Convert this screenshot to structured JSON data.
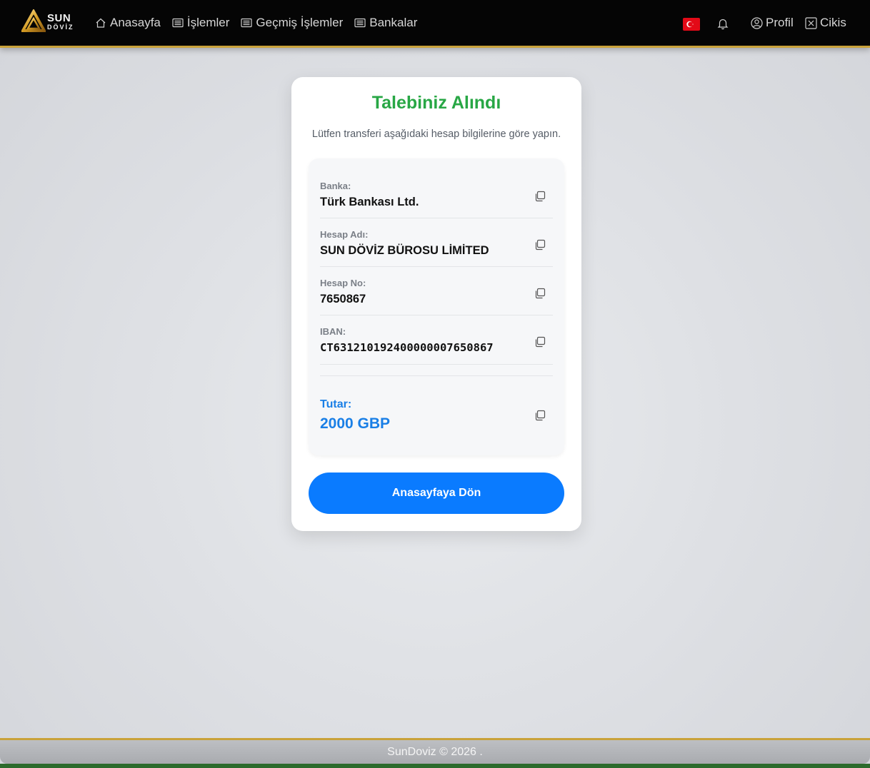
{
  "nav": {
    "logo_sun": "SUN",
    "logo_doviz": "DÖVİZ",
    "links": [
      {
        "label": "Anasayfa",
        "icon": "home-icon"
      },
      {
        "label": "İşlemler",
        "icon": "list-icon"
      },
      {
        "label": "Geçmiş İşlemler",
        "icon": "list-icon"
      },
      {
        "label": "Bankalar",
        "icon": "list-icon"
      }
    ],
    "flag": "turkey-flag-icon",
    "bell": "bell-icon",
    "profile_label": "Profil",
    "logout_label": "Cikis"
  },
  "card": {
    "title": "Talebiniz Alındı",
    "subtitle": "Lütfen transferi aşağıdaki hesap bilgilerine göre yapın.",
    "rows": [
      {
        "label": "Banka:",
        "value": "Türk Bankası Ltd."
      },
      {
        "label": "Hesap Adı:",
        "value": "SUN DÖVİZ BÜROSU LİMİTED"
      },
      {
        "label": "Hesap No:",
        "value": "7650867"
      },
      {
        "label": "IBAN:",
        "value": "CT631210192400000007650867"
      }
    ],
    "amount_label": "Tutar:",
    "amount_value": "2000 GBP",
    "home_button": "Anasayfaya Dön"
  },
  "footer": {
    "text": "SunDoviz © 2026 ."
  },
  "colors": {
    "accent": "#0a7bff",
    "success": "#28a745",
    "gold": "#c9a23a",
    "navbar": "#050505"
  }
}
